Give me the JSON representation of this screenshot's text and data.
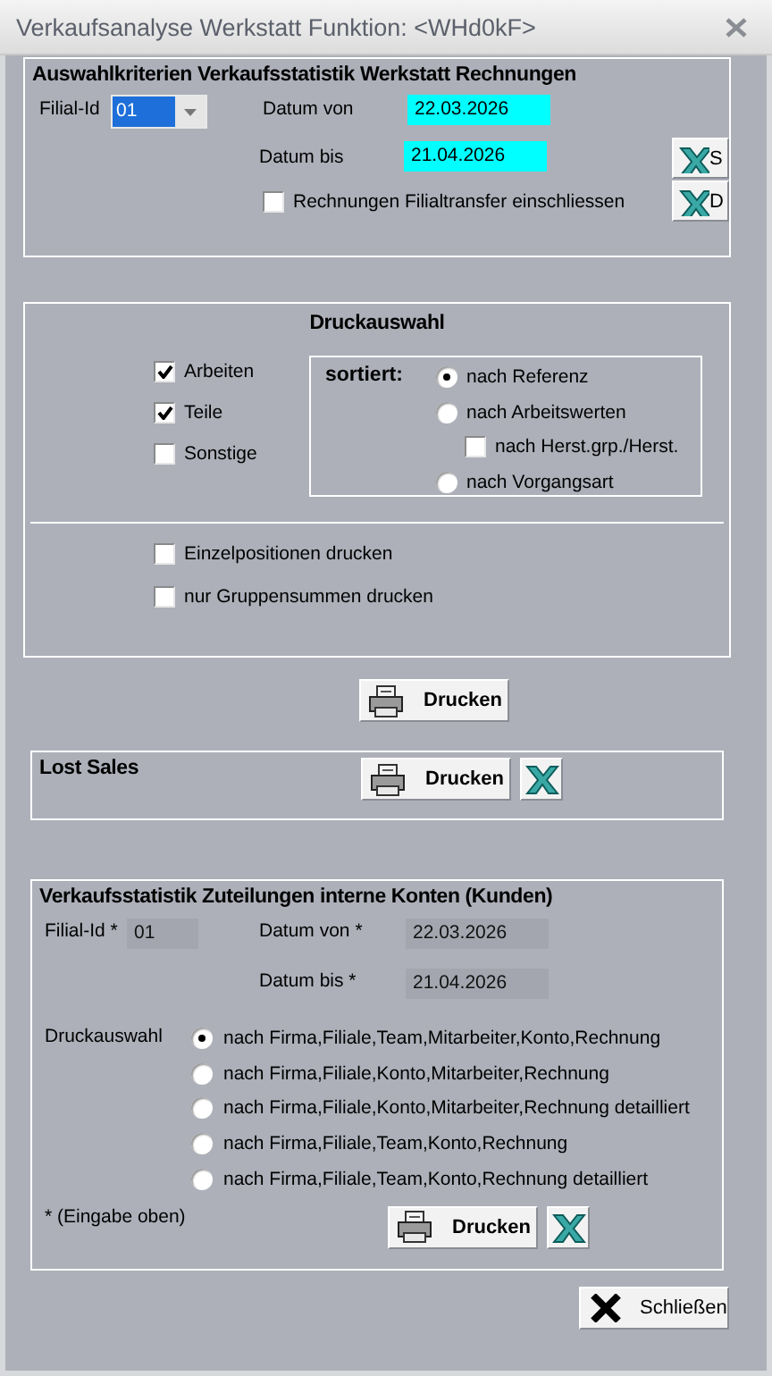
{
  "window": {
    "title": "Verkaufsanalyse Werkstatt Funktion: <WHd0kF>"
  },
  "auswahl": {
    "title": "Auswahlkriterien Verkaufsstatistik Werkstatt Rechnungen",
    "filial_label": "Filial-Id",
    "filial_value": "01",
    "von_label": "Datum von",
    "von_value": "22.03.2026",
    "bis_label": "Datum bis",
    "bis_value": "21.04.2026",
    "transfer": {
      "label": "Rechnungen Filialtransfer einschliessen",
      "checked": false
    },
    "export_buttons": [
      {
        "label": "S"
      },
      {
        "label": "D"
      }
    ]
  },
  "druckauswahl": {
    "title": "Druckauswahl",
    "types": [
      {
        "label": "Arbeiten",
        "checked": true
      },
      {
        "label": "Teile",
        "checked": true
      },
      {
        "label": "Sonstige",
        "checked": false
      }
    ],
    "sort_label": "sortiert:",
    "sort_options": [
      {
        "kind": "radio",
        "label": "nach Referenz",
        "selected": true
      },
      {
        "kind": "radio",
        "label": "nach Arbeitswerten",
        "selected": false
      },
      {
        "kind": "checkbox",
        "label": "nach Herst.grp./Herst.",
        "checked": false
      },
      {
        "kind": "radio",
        "label": "nach Vorgangsart",
        "selected": false
      }
    ],
    "options": [
      {
        "label": "Einzelpositionen drucken",
        "checked": false
      },
      {
        "label": "nur Gruppensummen drucken",
        "checked": false
      }
    ]
  },
  "print_button": {
    "label": "Drucken"
  },
  "lost_sales": {
    "title": "Lost Sales",
    "print_label": "Drucken"
  },
  "interne_konten": {
    "title": "Verkaufsstatistik Zuteilungen interne Konten (Kunden)",
    "filial_label": "Filial-Id *",
    "filial_value": "01",
    "von_label": "Datum von *",
    "von_value": "22.03.2026",
    "bis_label": "Datum bis *",
    "bis_value": "21.04.2026",
    "druck_label": "Druckauswahl",
    "options": [
      {
        "label": "nach Firma,Filiale,Team,Mitarbeiter,Konto,Rechnung",
        "selected": true
      },
      {
        "label": "nach Firma,Filiale,Konto,Mitarbeiter,Rechnung",
        "selected": false
      },
      {
        "label": "nach Firma,Filiale,Konto,Mitarbeiter,Rechnung detailliert",
        "selected": false
      },
      {
        "label": "nach Firma,Filiale,Team,Konto,Rechnung",
        "selected": false
      },
      {
        "label": "nach Firma,Filiale,Team,Konto,Rechnung detailliert",
        "selected": false
      }
    ],
    "note": "* (Eingabe oben)",
    "print_label": "Drucken"
  },
  "close_button": {
    "label": "Schließen"
  }
}
